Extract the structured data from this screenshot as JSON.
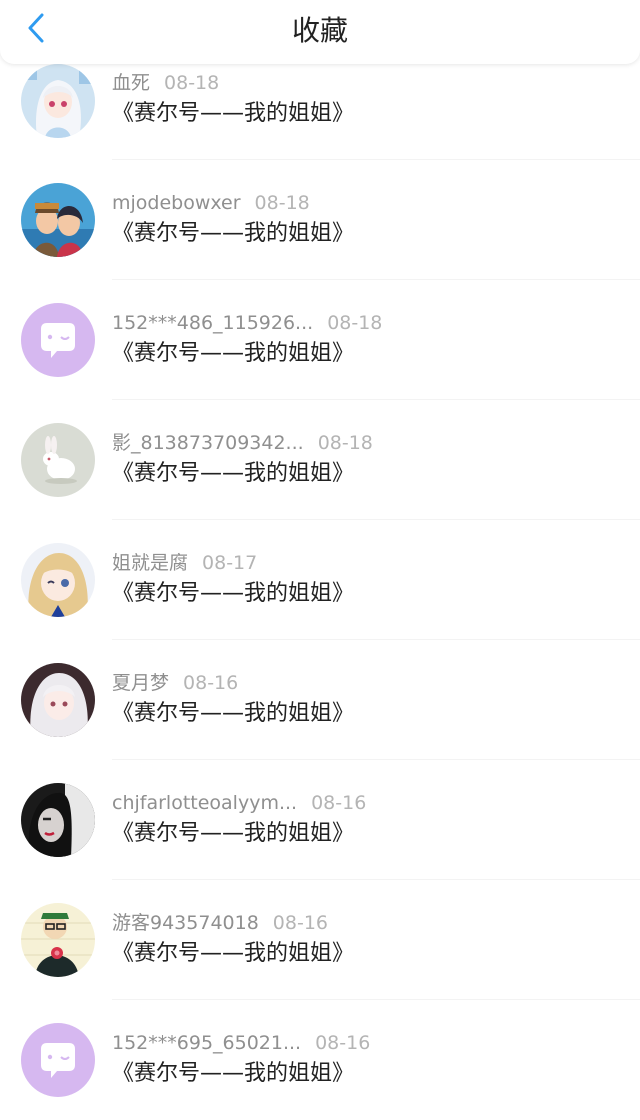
{
  "header": {
    "title": "收藏",
    "back_icon": "chevron-left-icon",
    "accent": "#2e9bf0"
  },
  "items": [
    {
      "name": "血死",
      "date": "08-18",
      "title": "《赛尔号——我的姐姐》",
      "avatar": "anime-girl-white-hair"
    },
    {
      "name": "mjodebowxer",
      "date": "08-18",
      "title": "《赛尔号——我的姐姐》",
      "avatar": "anime-couple"
    },
    {
      "name": "152***486_115926...",
      "date": "08-18",
      "title": "《赛尔号——我的姐姐》",
      "avatar": "default-chat-bubble"
    },
    {
      "name": "影_813873709342...",
      "date": "08-18",
      "title": "《赛尔号——我的姐姐》",
      "avatar": "white-rabbit"
    },
    {
      "name": "姐就是腐",
      "date": "08-17",
      "title": "《赛尔号——我的姐姐》",
      "avatar": "anime-girl-winking"
    },
    {
      "name": "夏月梦",
      "date": "08-16",
      "title": "《赛尔号——我的姐姐》",
      "avatar": "anime-girl-silver-hair"
    },
    {
      "name": "chjfarlotteoalyym...",
      "date": "08-16",
      "title": "《赛尔号——我的姐姐》",
      "avatar": "dark-portrait"
    },
    {
      "name": "游客943574018",
      "date": "08-16",
      "title": "《赛尔号——我的姐姐》",
      "avatar": "cartoon-man-flower"
    },
    {
      "name": "152***695_65021...",
      "date": "08-16",
      "title": "《赛尔号——我的姐姐》",
      "avatar": "default-chat-bubble"
    }
  ],
  "colors": {
    "default_avatar": "#d6b8f0",
    "name_text": "#8f8f8f",
    "date_text": "#b4b4b4",
    "title_text": "#222222"
  }
}
